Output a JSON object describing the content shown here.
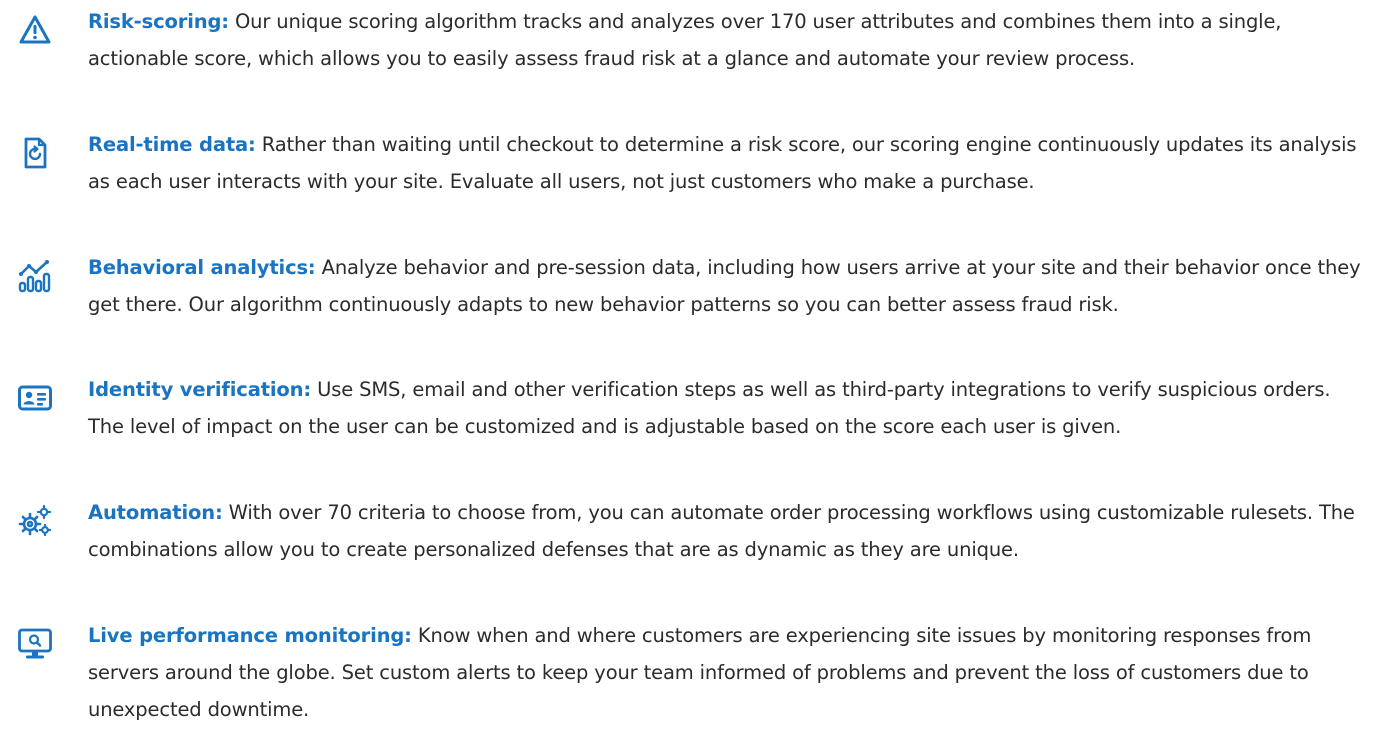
{
  "accent_color": "#1b74c2",
  "features": [
    {
      "icon": "warning-triangle-icon",
      "title": "Risk-scoring:",
      "body": "Our unique scoring algorithm tracks and analyzes over 170 user attributes and combines them into a single, actionable score, which allows you to easily assess fraud risk at a glance and automate your review process."
    },
    {
      "icon": "mobile-refresh-icon",
      "title": "Real-time data:",
      "body": "Rather than waiting until checkout to determine a risk score, our scoring engine continuously updates its analysis as each user interacts with your site. Evaluate all users, not just customers who make a purchase."
    },
    {
      "icon": "chart-analytics-icon",
      "title": "Behavioral analytics:",
      "body": "Analyze behavior and pre-session data, including how users arrive at your site and their behavior once they get there. Our algorithm continuously adapts to new behavior patterns so you can better assess fraud risk."
    },
    {
      "icon": "id-card-icon",
      "title": "Identity verification:",
      "body": "Use SMS, email and other verification steps as well as third-party integrations to verify suspicious orders. The level of impact on the user can be customized and is adjustable based on the score each user is given."
    },
    {
      "icon": "gears-icon",
      "title": "Automation:",
      "body": "With over 70 criteria to choose from, you can automate order processing workflows using customizable rulesets. The combinations allow you to create personalized defenses that are as dynamic as they are unique."
    },
    {
      "icon": "monitor-search-icon",
      "title": "Live performance monitoring:",
      "body": "Know when and where customers are experiencing site issues by monitoring responses from servers around the globe. Set custom alerts to keep your team informed of problems and prevent the loss of customers due to unexpected downtime."
    }
  ]
}
